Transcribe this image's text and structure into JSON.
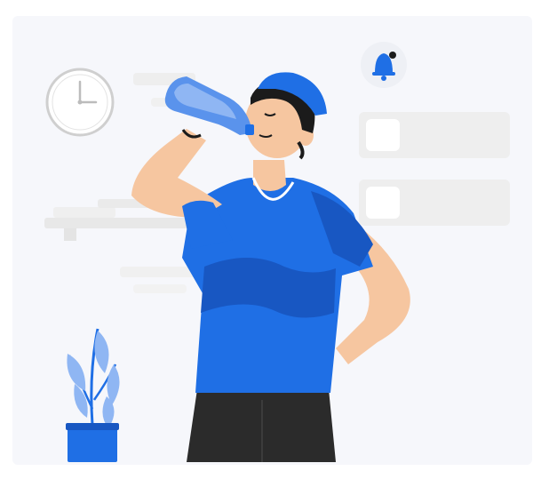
{
  "illustration": {
    "subject": "person-drinking-water",
    "icons": [
      "bell-icon",
      "clock-icon",
      "plant-icon",
      "water-bottle-icon"
    ],
    "colors": {
      "primary": "#1f6fe5",
      "primary_dark": "#1857c2",
      "light_blue": "#8fb6f3",
      "skin": "#f6c6a0",
      "hair": "#1b1b1b",
      "pants": "#2b2b2b",
      "background": "#f6f7fb",
      "panel": "#eeeeee"
    }
  }
}
